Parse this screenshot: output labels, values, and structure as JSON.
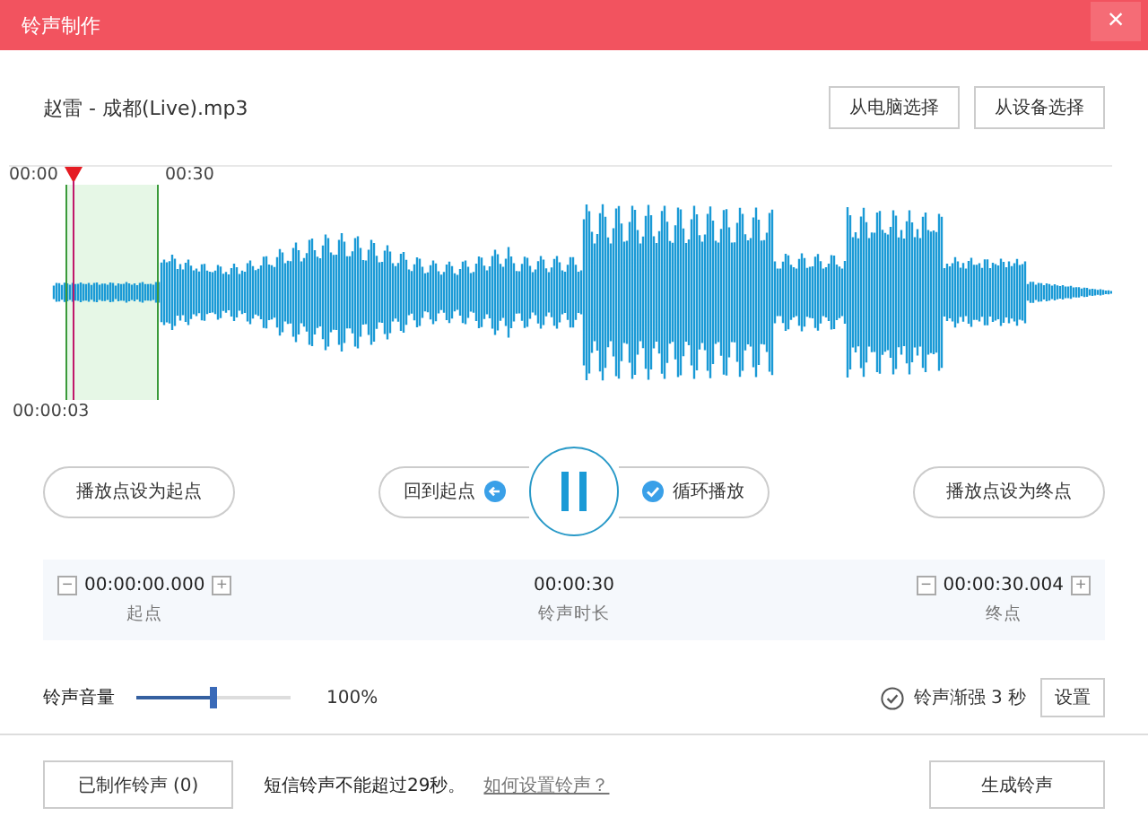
{
  "window": {
    "title": "铃声制作",
    "close": "×"
  },
  "file": {
    "name": "赵雷 - 成都(Live).mp3",
    "buttons": [
      "从电脑选择",
      "从设备选择"
    ]
  },
  "waveform": {
    "ruler_labels": [
      "00:00",
      "00:30"
    ],
    "playhead_time": "00:00:03"
  },
  "controls": {
    "set_start": "播放点设为起点",
    "back_to_start": "回到起点",
    "loop": {
      "label": "循环播放",
      "checked": true
    },
    "set_end": "播放点设为终点"
  },
  "times": [
    {
      "value": "00:00:00.000",
      "label": "起点",
      "minus": "−",
      "plus": "+"
    },
    {
      "value": "00:00:30",
      "label": "铃声时长"
    },
    {
      "value": "00:00:30.004",
      "label": "终点",
      "minus": "−",
      "plus": "+"
    }
  ],
  "volume": {
    "label": "铃声音量",
    "level": 0.5,
    "reading": "100%"
  },
  "fade": {
    "label": "铃声渐强 3 秒",
    "checked": true,
    "button": "设置"
  },
  "footer": {
    "made_button": "已制作铃声 (0)",
    "note": "短信铃声不能超过29秒。",
    "help_link": "如何设置铃声？",
    "generate_button": "生成铃声"
  }
}
